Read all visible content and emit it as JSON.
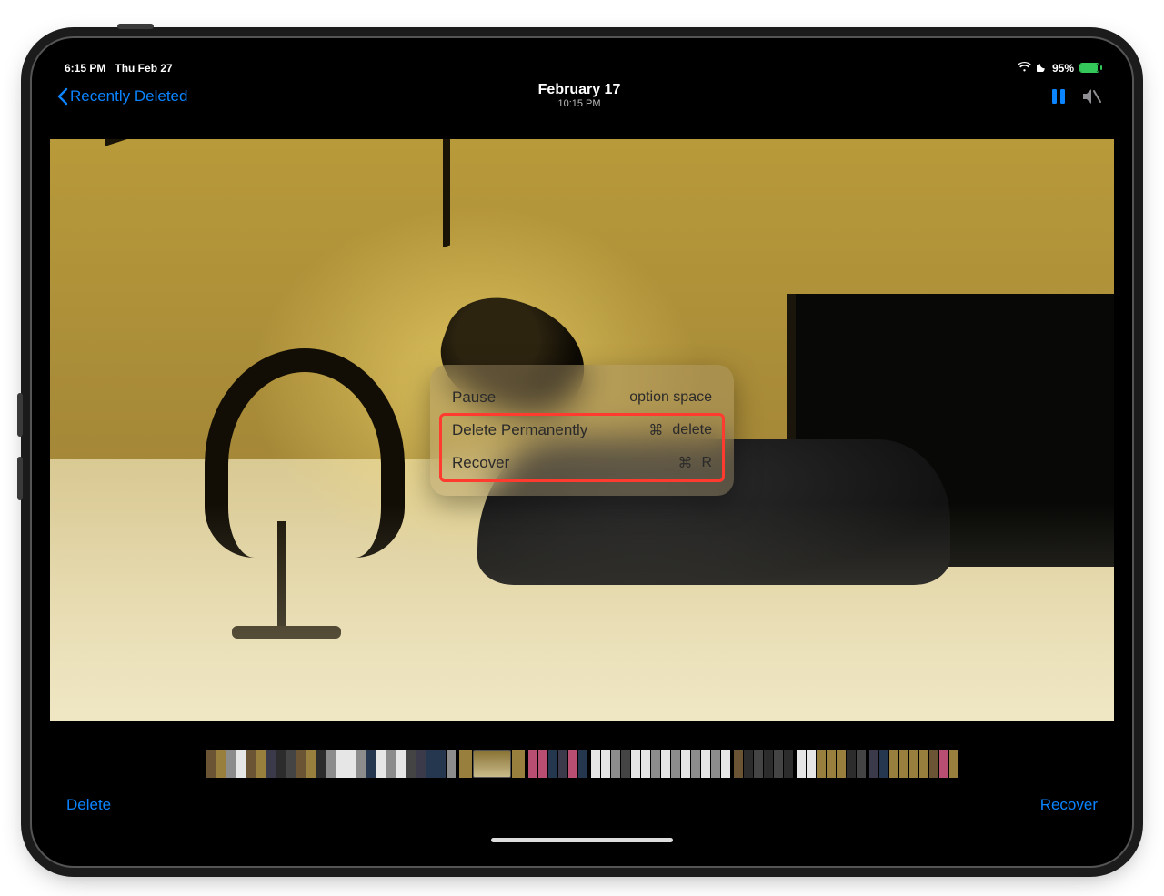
{
  "statusbar": {
    "time": "6:15 PM",
    "date": "Thu Feb 27",
    "battery_pct": "95%"
  },
  "navbar": {
    "back_label": "Recently Deleted",
    "title": "February 17",
    "subtitle": "10:15 PM"
  },
  "shortcuts": {
    "row1_label": "Pause",
    "row1_keys": "option space",
    "row2_label": "Delete Permanently",
    "row2_mod": "⌘",
    "row2_key": "delete",
    "row3_label": "Recover",
    "row3_mod": "⌘",
    "row3_key": "R"
  },
  "toolbar": {
    "delete_label": "Delete",
    "recover_label": "Recover"
  }
}
